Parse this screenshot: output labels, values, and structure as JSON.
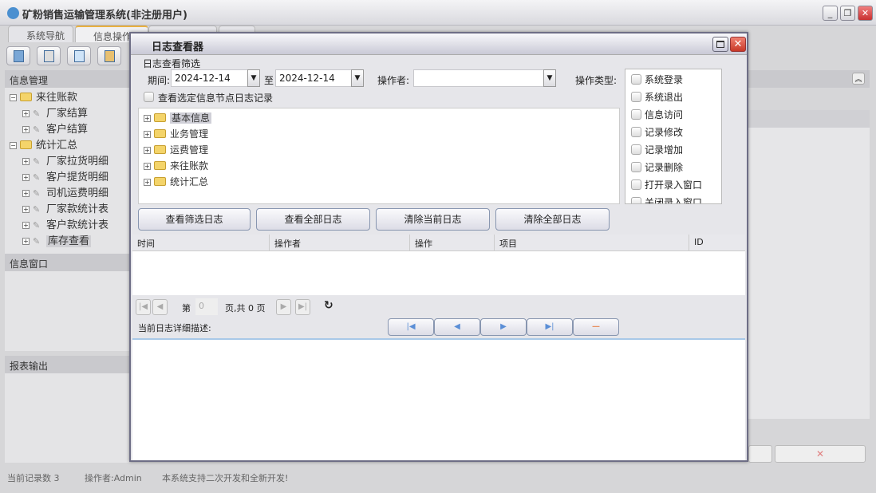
{
  "app": {
    "title": "矿粉销售运输管理系统(非注册用户)",
    "minimize": "_",
    "maximize": "❐",
    "close": "✕"
  },
  "tabs": [
    {
      "label": "系统导航"
    },
    {
      "label": "信息操作"
    },
    {
      "label": ""
    },
    {
      "label": ""
    }
  ],
  "sidebar": {
    "info_mgmt": "信息管理",
    "tree": [
      {
        "label": "来往账款",
        "type": "folder",
        "expanded": true
      },
      {
        "label": "厂家结算",
        "type": "leaf"
      },
      {
        "label": "客户结算",
        "type": "leaf"
      },
      {
        "label": "统计汇总",
        "type": "folder",
        "expanded": true
      },
      {
        "label": "厂家拉货明细",
        "type": "leaf"
      },
      {
        "label": "客户提货明细",
        "type": "leaf"
      },
      {
        "label": "司机运费明细",
        "type": "leaf"
      },
      {
        "label": "厂家款统计表",
        "type": "leaf"
      },
      {
        "label": "客户款统计表",
        "type": "leaf"
      },
      {
        "label": "库存查看",
        "type": "leaf",
        "selected": true
      }
    ],
    "info_window": "信息窗口",
    "report_output": "报表输出"
  },
  "background_right": {
    "delete_icon": "✕",
    "collapse_icon": "︽"
  },
  "status": {
    "records": "当前记录数 3",
    "operator": "操作者:Admin",
    "note": "本系统支持二次开发和全新开发!"
  },
  "dialog": {
    "title": "日志查看器",
    "filter_label": "日志查看筛选",
    "period_label": "期间:",
    "date_from": "2024-12-14",
    "to_label": "至",
    "date_to": "2024-12-14",
    "operator_label": "操作者:",
    "operator_value": "",
    "optype_label": "操作类型:",
    "optypes": [
      "系统登录",
      "系统退出",
      "信息访问",
      "记录修改",
      "记录增加",
      "记录删除",
      "打开录入窗口",
      "关闭录入窗口"
    ],
    "node_checkbox": "查看选定信息节点日志记录",
    "tree": [
      {
        "label": "基本信息",
        "selected": true
      },
      {
        "label": "业务管理"
      },
      {
        "label": "运费管理"
      },
      {
        "label": "来往账款"
      },
      {
        "label": "统计汇总"
      }
    ],
    "buttons": {
      "view_filtered": "查看筛选日志",
      "view_all": "查看全部日志",
      "clear_current": "清除当前日志",
      "clear_all": "清除全部日志"
    },
    "columns": [
      "时间",
      "操作者",
      "操作",
      "项目",
      "ID"
    ],
    "pager": {
      "page_prefix": "第",
      "page_value": "0",
      "page_suffix": "页,共 0 页"
    },
    "detail_label": "当前日志详细描述:",
    "nav_icons": {
      "first": "|◀",
      "prev": "◀",
      "next": "▶",
      "last": "▶|",
      "remove": "—"
    }
  }
}
